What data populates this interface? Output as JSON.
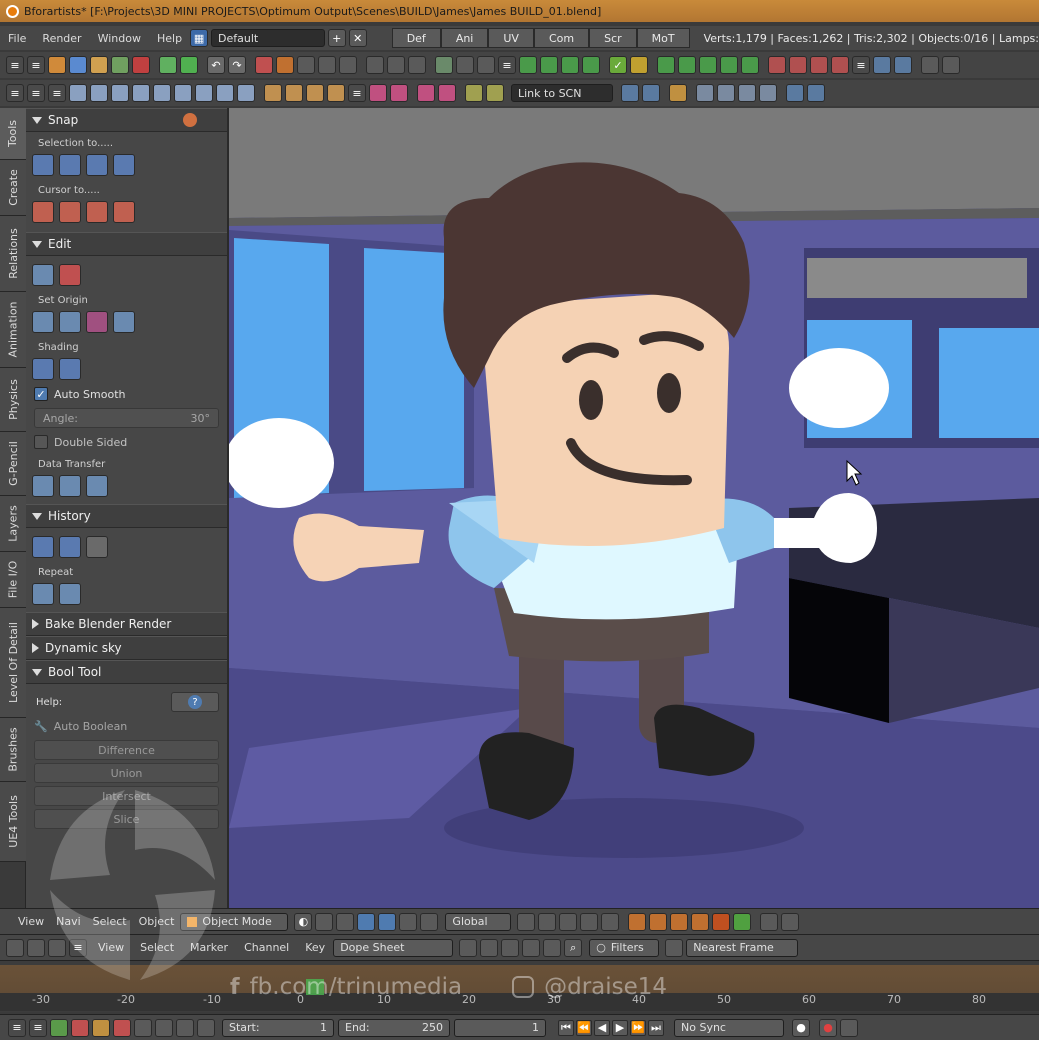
{
  "app": {
    "window_title": "Bforartists* [F:\\Projects\\3D MINI PROJECTS\\Optimum Output\\Scenes\\BUILD\\James\\James BUILD_01.blend]"
  },
  "menu": {
    "items": [
      "File",
      "Render",
      "Window",
      "Help"
    ],
    "layout": "Default",
    "workspaces": [
      "Def",
      "Ani",
      "UV",
      "Com",
      "Scr",
      "MoT"
    ],
    "stats": "Verts:1,179 | Faces:1,262 | Tris:2,302 | Objects:0/16 | Lamps:"
  },
  "toolbar": {
    "link_to": "Link to SCN"
  },
  "side_tabs": [
    "Tools",
    "Create",
    "Relations",
    "Animation",
    "Physics",
    "G-Pencil",
    "Layers",
    "File I/O",
    "Level Of Detail",
    "Brushes",
    "UE4 Tools"
  ],
  "panel": {
    "snap": {
      "title": "Snap",
      "selection_to": "Selection to.....",
      "cursor_to": "Cursor to....."
    },
    "edit": {
      "title": "Edit",
      "set_origin": "Set Origin",
      "shading": "Shading",
      "auto_smooth": "Auto Smooth",
      "angle_label": "Angle:",
      "angle_value": "30°",
      "double_sided": "Double Sided",
      "data_transfer": "Data Transfer"
    },
    "history": {
      "title": "History",
      "repeat": "Repeat"
    },
    "bake": "Bake Blender Render",
    "dynamic_sky": "Dynamic sky",
    "bool_tool": {
      "title": "Bool Tool",
      "help": "Help:",
      "help_icon": "?",
      "auto_boolean": "Auto Boolean",
      "difference": "Difference",
      "union": "Union",
      "intersect": "Intersect",
      "slice": "Slice"
    }
  },
  "viewport_header": {
    "view": "View",
    "navi": "Navi",
    "select": "Select",
    "object": "Object",
    "mode": "Object Mode",
    "orientation": "Global"
  },
  "timeline_header": {
    "view": "View",
    "select": "Select",
    "marker": "Marker",
    "channel": "Channel",
    "key": "Key",
    "editor": "Dope Sheet",
    "filters": "Filters",
    "snap": "Nearest Frame"
  },
  "timeline": {
    "ticks": [
      -30,
      -20,
      -10,
      0,
      10,
      20,
      30,
      40,
      50,
      60,
      70,
      80
    ]
  },
  "playback": {
    "start_label": "Start:",
    "start_value": "1",
    "end_label": "End:",
    "end_value": "250",
    "current": "1",
    "sync": "No Sync"
  },
  "watermark": {
    "facebook": "fb.com/trinumedia",
    "instagram": "@draise14"
  },
  "colors": {
    "accent": "#c98a3a",
    "wall": "#5b5a9c",
    "sky": "#5aa9ef",
    "skin": "#f5d2b4",
    "hair": "#4a3634",
    "shirt": "#9fd0f0"
  }
}
